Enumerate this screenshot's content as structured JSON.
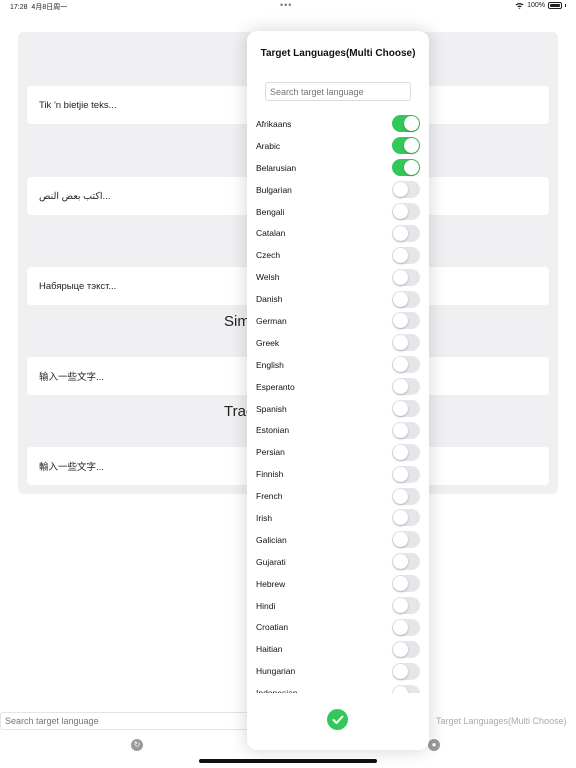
{
  "status_bar": {
    "time": "17:28",
    "date": "4月8日周一",
    "battery": "100%",
    "wifi_icon": "wifi-icon"
  },
  "background": {
    "cards": [
      "Tik 'n bietjie teks...",
      "اكتب بعض النص...",
      "Набярыце тэкст...",
      "输入一些文字...",
      "輸入一些文字..."
    ],
    "headings": [
      "Sim",
      "Trac"
    ]
  },
  "bottom_bar": {
    "search_placeholder": "Search target language",
    "target_label": "Target Languages(Multi Choose)",
    "tabs": [
      "refresh-icon",
      "person-icon"
    ]
  },
  "modal": {
    "title": "Target Languages(Multi Choose)",
    "search_placeholder": "Search target language",
    "languages": [
      {
        "name": "Afrikaans",
        "on": true
      },
      {
        "name": "Arabic",
        "on": true
      },
      {
        "name": "Belarusian",
        "on": true
      },
      {
        "name": "Bulgarian",
        "on": false
      },
      {
        "name": "Bengali",
        "on": false
      },
      {
        "name": "Catalan",
        "on": false
      },
      {
        "name": "Czech",
        "on": false
      },
      {
        "name": "Welsh",
        "on": false
      },
      {
        "name": "Danish",
        "on": false
      },
      {
        "name": "German",
        "on": false
      },
      {
        "name": "Greek",
        "on": false
      },
      {
        "name": "English",
        "on": false
      },
      {
        "name": "Esperanto",
        "on": false
      },
      {
        "name": "Spanish",
        "on": false
      },
      {
        "name": "Estonian",
        "on": false
      },
      {
        "name": "Persian",
        "on": false
      },
      {
        "name": "Finnish",
        "on": false
      },
      {
        "name": "French",
        "on": false
      },
      {
        "name": "Irish",
        "on": false
      },
      {
        "name": "Galician",
        "on": false
      },
      {
        "name": "Gujarati",
        "on": false
      },
      {
        "name": "Hebrew",
        "on": false
      },
      {
        "name": "Hindi",
        "on": false
      },
      {
        "name": "Croatian",
        "on": false
      },
      {
        "name": "Haitian",
        "on": false
      },
      {
        "name": "Hungarian",
        "on": false
      },
      {
        "name": "Indonesian",
        "on": false
      }
    ],
    "confirm_icon": "checkmark-icon",
    "accent_color": "#34c759"
  }
}
